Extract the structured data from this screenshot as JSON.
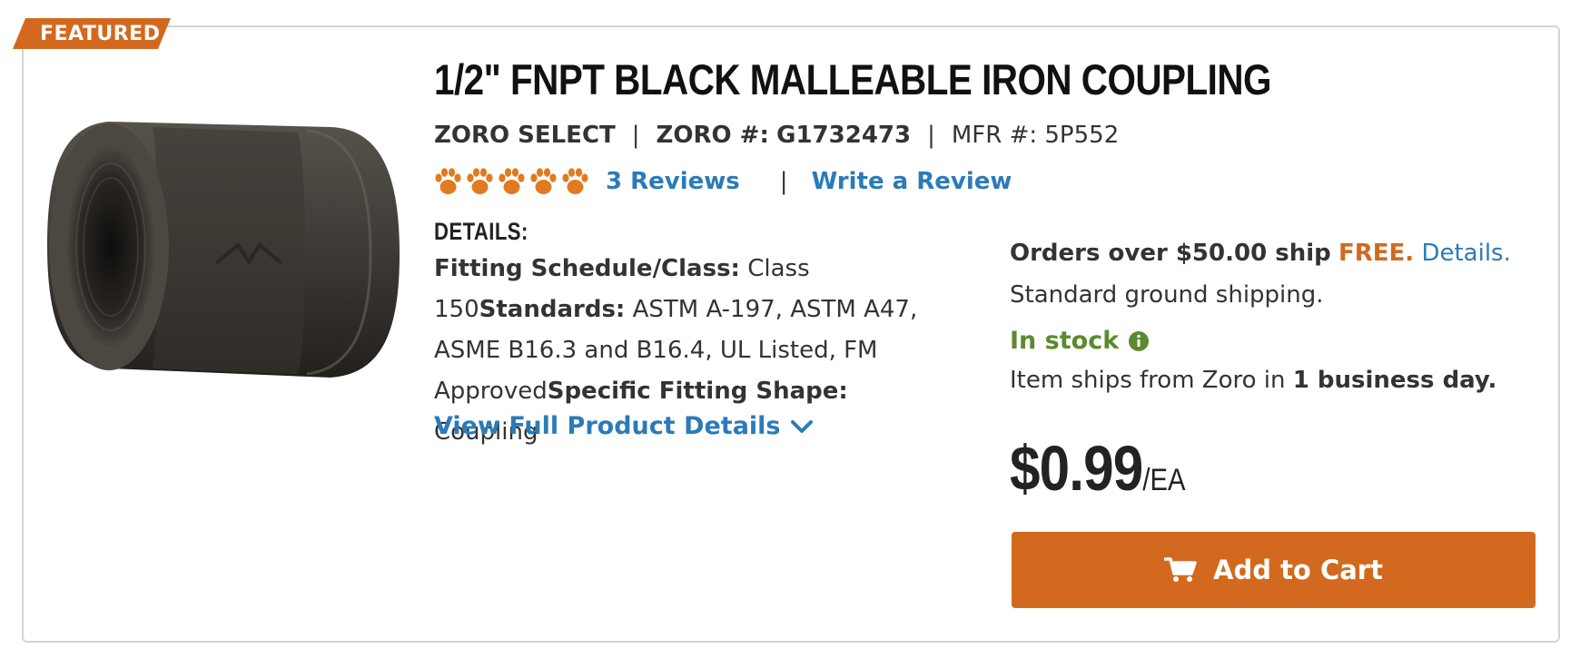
{
  "badge": {
    "label": "FEATURED"
  },
  "product": {
    "title": "1/2\" FNPT BLACK MALLEABLE IRON COUPLING",
    "brand": "ZORO SELECT",
    "zoro_label": "ZORO #:",
    "zoro_number": "G1732473",
    "mfr_label": "MFR #:",
    "mfr_number": "5P552",
    "rating_icons": 5,
    "reviews_link": "3 Reviews",
    "write_review_link": "Write a Review",
    "image_icon": "pipe-coupling-photo"
  },
  "details": {
    "heading": "DETAILS:",
    "items": [
      {
        "label": "Fitting Schedule/Class:",
        "value": " Class 150"
      },
      {
        "label": "Standards:",
        "value": " ASTM A-197, ASTM A47, ASME B16.3 and B16.4, UL Listed, FM Approved"
      },
      {
        "label": "Specific Fitting Shape:",
        "value": " Coupling"
      }
    ],
    "view_full": "View Full Product Details"
  },
  "shipping": {
    "orders_over": "Orders over $50.00 ship",
    "free": "FREE.",
    "details_link": "Details.",
    "standard": "Standard ground shipping.",
    "stock": "In stock",
    "ships_from_prefix": "Item ships from Zoro in ",
    "ships_time": "1 business day."
  },
  "price": {
    "value": "$0.99",
    "unit": "/EA"
  },
  "cart": {
    "label": "Add to Cart"
  },
  "colors": {
    "accent": "#d2691e",
    "link": "#2b7bb9",
    "stock": "#5b8a2e",
    "border": "#d4d4d4"
  }
}
